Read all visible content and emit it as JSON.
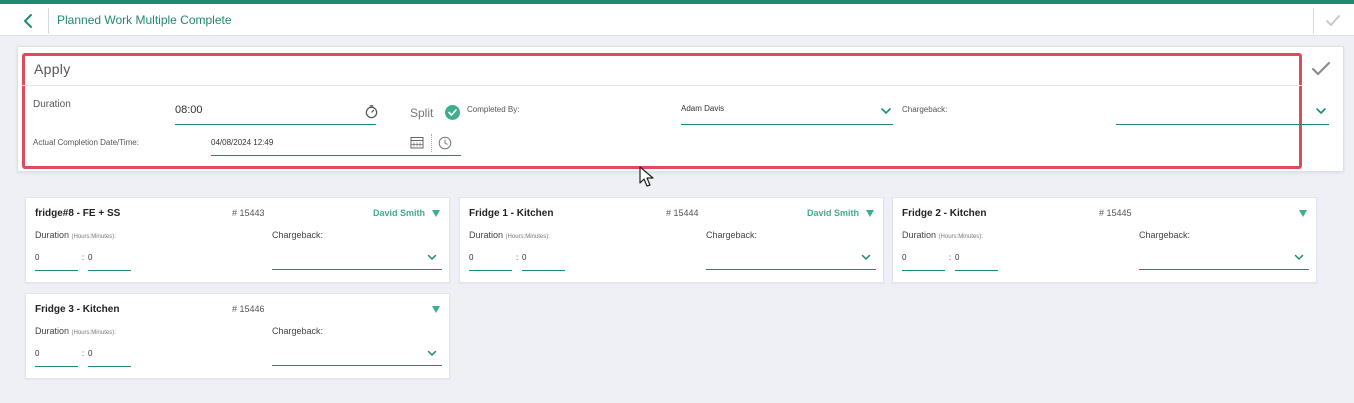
{
  "header": {
    "title": "Planned Work Multiple Complete",
    "back_icon": "chevron-left-icon",
    "confirm_icon": "check-icon"
  },
  "apply": {
    "title": "Apply",
    "duration_label": "Duration",
    "duration_value": "08:00",
    "split_label": "Split",
    "completed_by_label": "Completed By:",
    "completed_by_value": "Adam Davis",
    "chargeback_label": "Chargeback:",
    "chargeback_value": "",
    "completion_label": "Actual Completion Date/Time:",
    "completion_value": "04/08/2024 12:49"
  },
  "cards": [
    {
      "title": "fridge#8 - FE + SS",
      "number": "# 15443",
      "assignee": "David Smith",
      "duration_label": "Duration",
      "duration_hint": "(Hours:Minutes):",
      "hours": "0",
      "minutes": "0",
      "chargeback_label": "Chargeback:"
    },
    {
      "title": "Fridge 1 - Kitchen",
      "number": "# 15444",
      "assignee": "David Smith",
      "duration_label": "Duration",
      "duration_hint": "(Hours:Minutes):",
      "hours": "0",
      "minutes": "0",
      "chargeback_label": "Chargeback:"
    },
    {
      "title": "Fridge 2 - Kitchen",
      "number": "# 15445",
      "assignee": "",
      "duration_label": "Duration",
      "duration_hint": "(Hours:Minutes):",
      "hours": "0",
      "minutes": "0",
      "chargeback_label": "Chargeback:"
    },
    {
      "title": "Fridge 3 - Kitchen",
      "number": "# 15446",
      "assignee": "",
      "duration_label": "Duration",
      "duration_hint": "(Hours:Minutes):",
      "hours": "0",
      "minutes": "0",
      "chargeback_label": "Chargeback:"
    }
  ],
  "colors": {
    "accent": "#1f8a70",
    "accent_light": "#3fae8e",
    "highlight": "#e04a5a",
    "background": "#eef0f6"
  }
}
